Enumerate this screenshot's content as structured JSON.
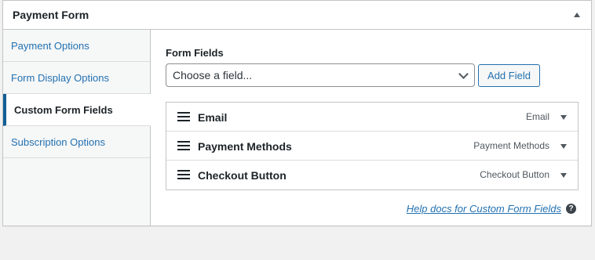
{
  "panel": {
    "title": "Payment Form"
  },
  "tabs": [
    {
      "label": "Payment Options",
      "active": false
    },
    {
      "label": "Form Display Options",
      "active": false
    },
    {
      "label": "Custom Form Fields",
      "active": true
    },
    {
      "label": "Subscription Options",
      "active": false
    }
  ],
  "form_fields": {
    "section_label": "Form Fields",
    "select_value": "Choose a field...",
    "add_button_label": "Add Field",
    "rows": [
      {
        "name": "Email",
        "type": "Email"
      },
      {
        "name": "Payment Methods",
        "type": "Payment Methods"
      },
      {
        "name": "Checkout Button",
        "type": "Checkout Button"
      }
    ],
    "help_link": "Help docs for Custom Form Fields",
    "help_icon": "?"
  },
  "colors": {
    "accent": "#2271b1",
    "active_tab_border": "#135e96"
  }
}
